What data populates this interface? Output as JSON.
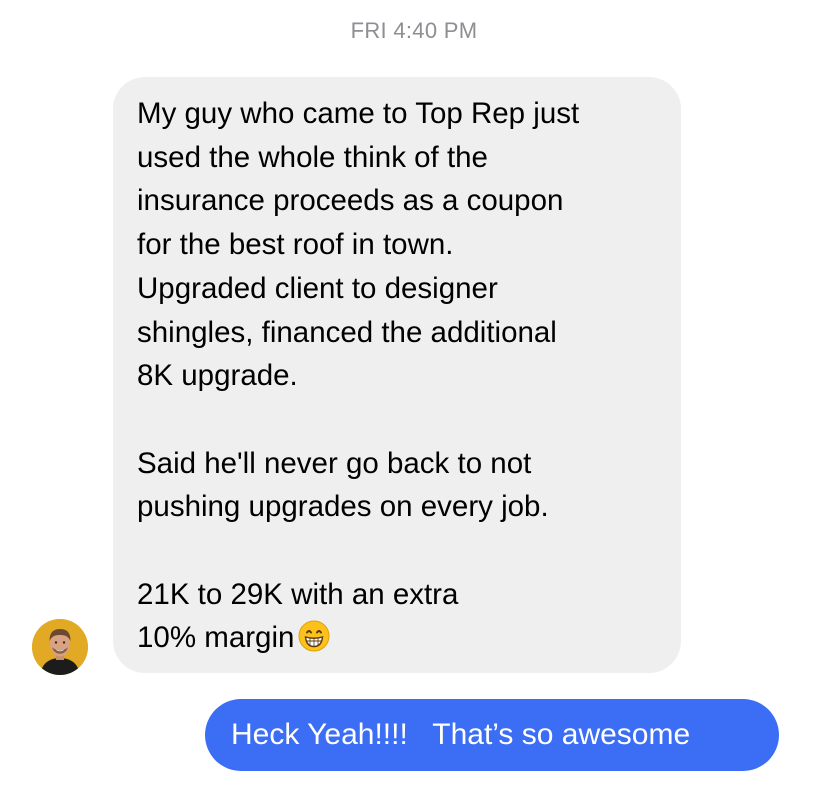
{
  "conversation": {
    "timestamp": "FRI 4:40 PM",
    "incoming": {
      "paragraphs": [
        "My guy who came to Top Rep just\nused the whole think of the\ninsurance proceeds as a coupon\nfor the best roof in town.\nUpgraded client to designer\nshingles, financed the additional\n8K upgrade.",
        "Said he'll never go back to not\npushing upgrades on every job.",
        "21K to 29K with an extra\n10% margin"
      ],
      "emoji": "grinning-face-with-smiling-eyes-emoji",
      "avatar_icon": "person-avatar"
    },
    "outgoing": {
      "text": "Heck Yeah!!!!   That’s so awesome"
    }
  },
  "colors": {
    "timestamp": "#8e8e93",
    "incoming_bubble": "#efefef",
    "outgoing_bubble": "#3b6ef5",
    "avatar_background": "#e2a924"
  }
}
